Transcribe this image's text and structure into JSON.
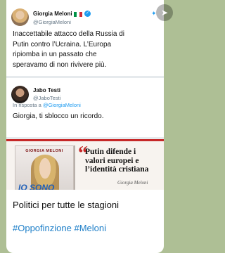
{
  "post": {
    "screenshot": {
      "tweet1": {
        "name": "Giorgia Meloni",
        "handle": "@GiorgiaMeloni",
        "text_lines": [
          "Inaccettabile attacco della Russia di",
          "Putin contro l’Ucraina. L’Europa",
          "ripiomba in un passato che",
          "speravamo di non rivivere più."
        ]
      },
      "tweet2": {
        "name": "Jabo Testi",
        "handle": "@JaboTesti",
        "reply_prefix": "In risposta a",
        "reply_to": "@GiorgiaMeloni",
        "text": "Giorgia, ti sblocco un ricordo."
      },
      "ad": {
        "book_author": "GIORGIA MELONI",
        "book_title": "IO SONO",
        "quote_lines": [
          "Putin difende i",
          "valori europei e",
          "l’identità cristiana"
        ],
        "signature": "Giorgia Meloni"
      }
    },
    "caption": "Politici per tutte le stagioni",
    "hashtags": [
      "#Oppofinzione",
      "#Meloni"
    ]
  },
  "colors": {
    "chat_background": "#aebf95",
    "hashtag": "#1e7fc8",
    "twitter_blue": "#1d9bf0",
    "accent_red": "#c62828"
  }
}
